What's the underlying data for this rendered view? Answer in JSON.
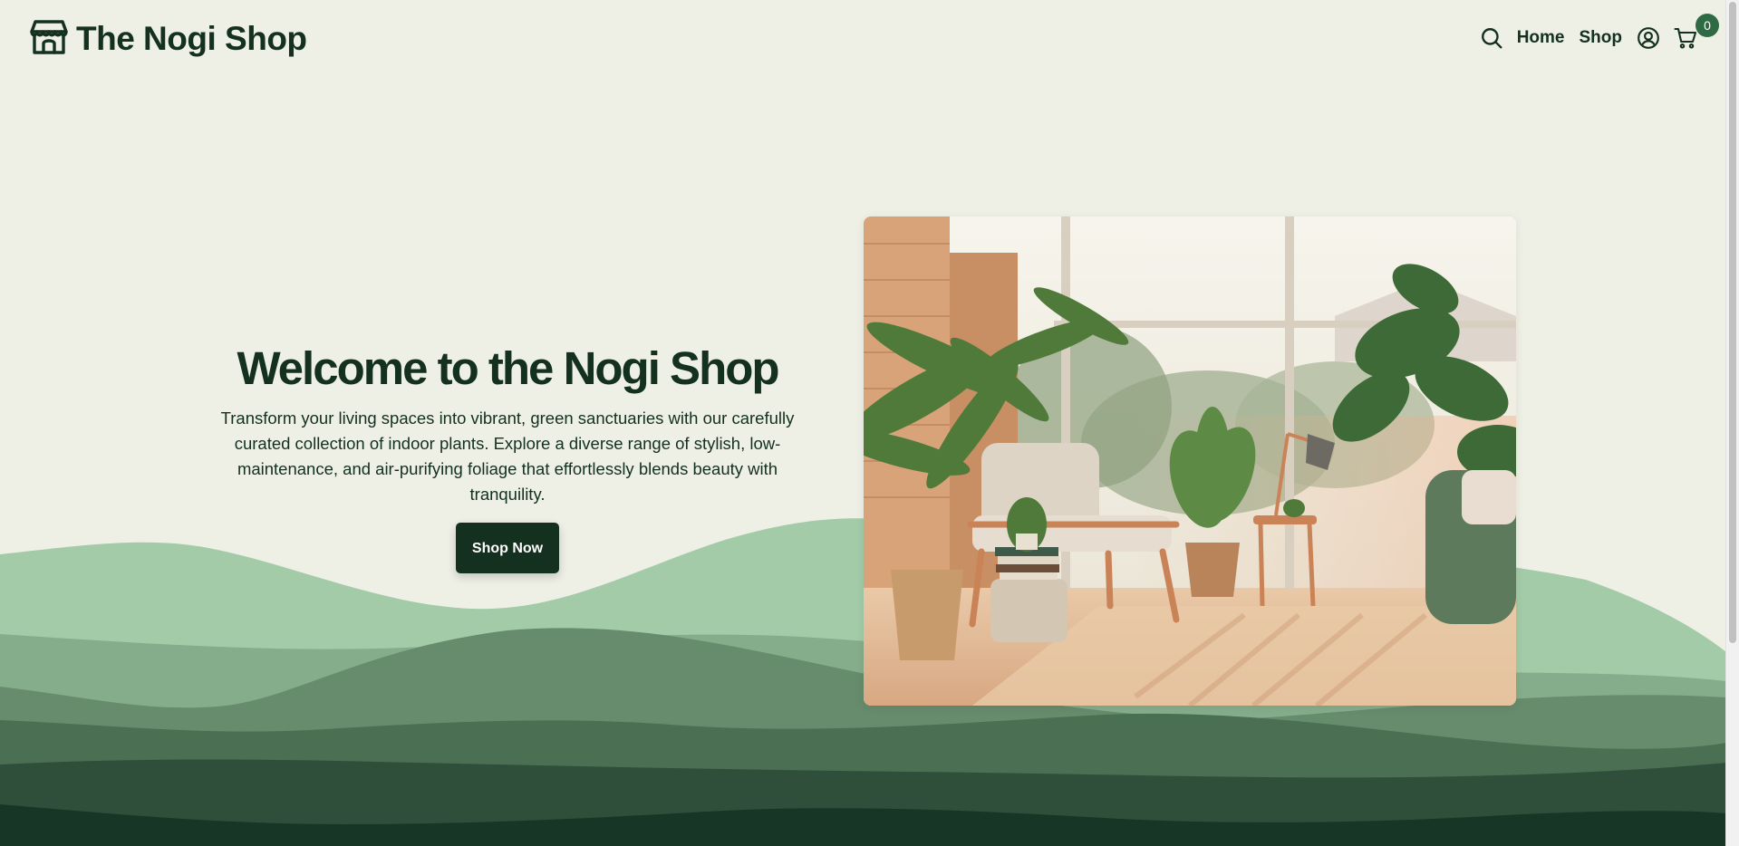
{
  "header": {
    "logo_text": "The Nogi Shop",
    "logo_icon": "storefront-icon",
    "nav": {
      "search_icon": "search-icon",
      "home_label": "Home",
      "shop_label": "Shop",
      "account_icon": "user-circle-icon",
      "cart_icon": "cart-icon",
      "cart_count": "0"
    }
  },
  "hero": {
    "title": "Welcome to the Nogi Shop",
    "description": "Transform your living spaces into vibrant, green sanctuaries with our carefully curated collection of indoor plants. Explore a diverse range of stylish, low-maintenance, and air-purifying foliage that effortlessly blends beauty with tranquility.",
    "button_label": "Shop Now",
    "image_alt": "Sunroom with armchair, side table and potted indoor plants"
  },
  "colors": {
    "background": "#eef0e6",
    "text": "#14301f",
    "button": "#14301f",
    "badge": "#2e6b45",
    "wave_1": "#a3cba8",
    "wave_2": "#86ad8b",
    "wave_3": "#678b6d",
    "wave_4": "#4a6f53",
    "wave_5": "#2f4f3a",
    "wave_6": "#183625"
  }
}
